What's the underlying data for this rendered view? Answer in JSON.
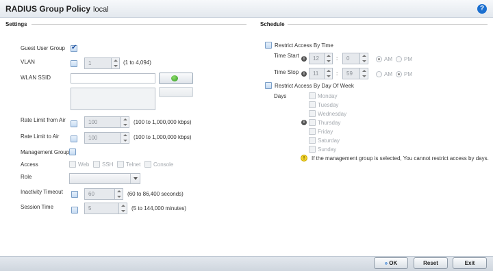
{
  "header": {
    "title": "RADIUS Group Policy",
    "subtitle": "local",
    "help_icon": "?"
  },
  "settings": {
    "section_title": "Settings",
    "guest_user_group": {
      "label": "Guest User Group",
      "checked": true
    },
    "vlan": {
      "label": "VLAN",
      "value": "1",
      "range": "(1 to 4,094)"
    },
    "wlan_ssid": {
      "label": "WLAN SSID",
      "value": ""
    },
    "rate_limit_from_air": {
      "label": "Rate Limit from Air",
      "value": "100",
      "range": "(100 to 1,000,000 kbps)"
    },
    "rate_limit_to_air": {
      "label": "Rate Limit to Air",
      "value": "100",
      "range": "(100 to 1,000,000 kbps)"
    },
    "management_group": {
      "label": "Management Group",
      "checked": false
    },
    "access": {
      "label": "Access",
      "options": [
        "Web",
        "SSH",
        "Telnet",
        "Console"
      ]
    },
    "role": {
      "label": "Role",
      "value": ""
    },
    "inactivity_timeout": {
      "label": "Inactivity Timeout",
      "value": "60",
      "range": "(60 to 86,400 seconds)"
    },
    "session_time": {
      "label": "Session Time",
      "value": "5",
      "range": "(5 to 144,000 minutes)"
    }
  },
  "schedule": {
    "section_title": "Schedule",
    "restrict_by_time": {
      "label": "Restrict Access By Time",
      "checked": false
    },
    "time_start": {
      "label": "Time Start",
      "hour": "12",
      "minute": "0",
      "am": "AM",
      "pm": "PM",
      "selected": "AM"
    },
    "time_stop": {
      "label": "Time Stop",
      "hour": "11",
      "minute": "59",
      "am": "AM",
      "pm": "PM",
      "selected": "PM"
    },
    "colon": ":",
    "restrict_by_day": {
      "label": "Restrict Access By Day Of Week",
      "checked": false
    },
    "days_label": "Days",
    "days": [
      "Monday",
      "Tuesday",
      "Wednesday",
      "Thursday",
      "Friday",
      "Saturday",
      "Sunday"
    ],
    "warning": "If the management group is selected, You cannot restrict access by days."
  },
  "footer": {
    "ok": "OK",
    "reset": "Reset",
    "exit": "Exit"
  }
}
